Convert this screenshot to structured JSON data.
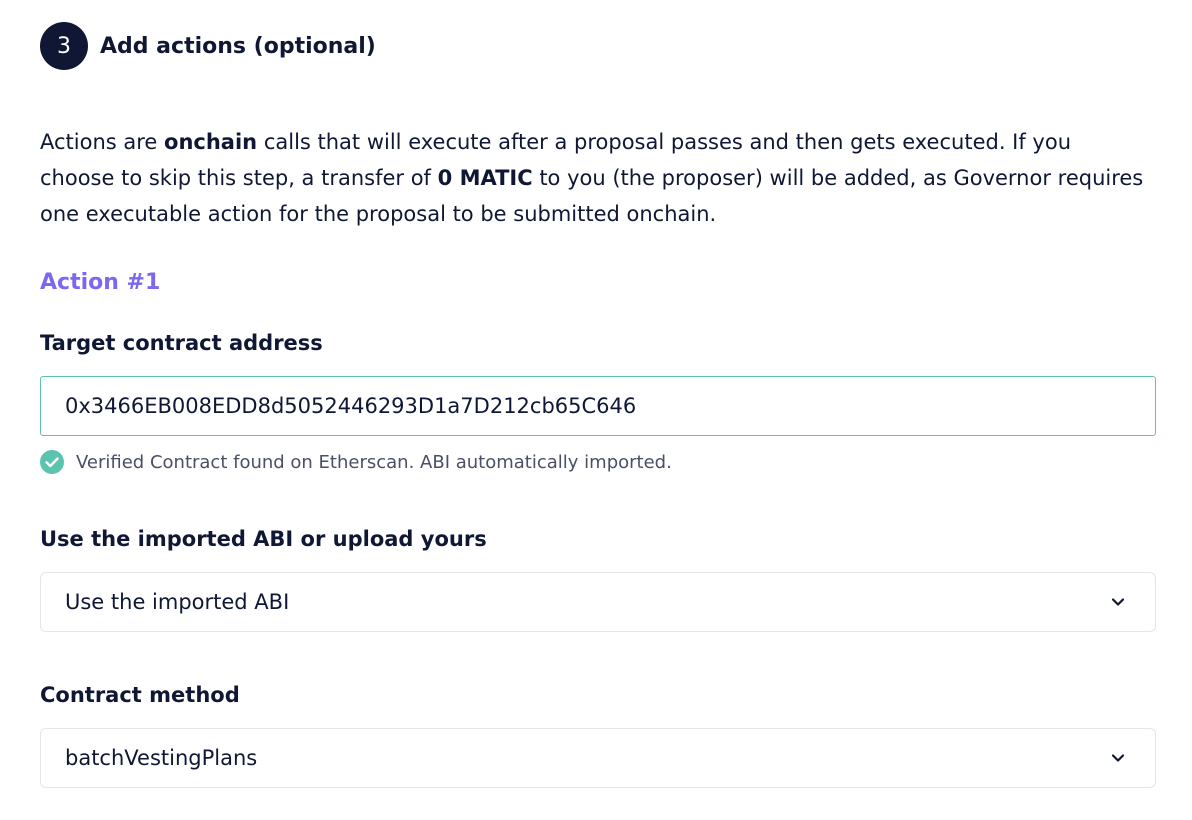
{
  "step": {
    "number": "3",
    "title": "Add actions (optional)"
  },
  "description": {
    "part1": "Actions are ",
    "bold1": "onchain",
    "part2": " calls that will execute after a proposal passes and then gets executed. If you choose to skip this step, a transfer of ",
    "bold2": "0 MATIC",
    "part3": " to you (the proposer) will be added, as Governor requires one executable action for the proposal to be submitted onchain."
  },
  "action": {
    "title": "Action #1",
    "target": {
      "label": "Target contract address",
      "value": "0x3466EB008EDD8d5052446293D1a7D212cb65C646",
      "verified_message": "Verified Contract found on Etherscan. ABI automatically imported."
    },
    "abi": {
      "label": "Use the imported ABI or upload yours",
      "selected": "Use the imported ABI"
    },
    "method": {
      "label": "Contract method",
      "selected": "batchVestingPlans"
    }
  },
  "colors": {
    "primary": "#0f1735",
    "accent": "#7b68ee",
    "success": "#5cc3ae"
  },
  "icons": {
    "verified": "check-circle-icon",
    "dropdown": "chevron-down-icon"
  }
}
